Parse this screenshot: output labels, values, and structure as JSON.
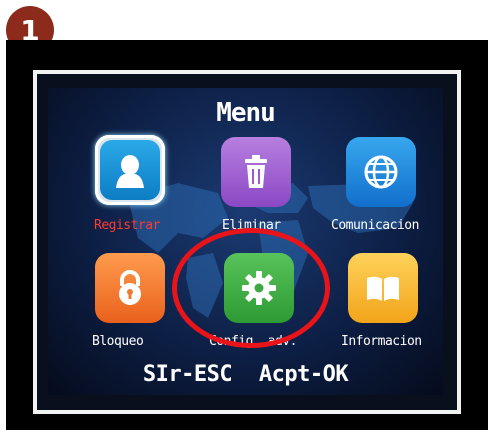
{
  "step": {
    "number": "1"
  },
  "screen": {
    "title": "Menu",
    "items": [
      {
        "label": "Registrar",
        "icon": "user-icon",
        "color": "#1f95dc",
        "selected": true
      },
      {
        "label": "Eliminar",
        "icon": "trash-icon",
        "color": "#9b5bd1",
        "selected": false
      },
      {
        "label": "Comunicacion",
        "icon": "globe-icon",
        "color": "#2a8ee6",
        "selected": false
      },
      {
        "label": "Bloqueo",
        "icon": "lock-icon",
        "color": "#f07a2f",
        "selected": false
      },
      {
        "label": "Config. adv.",
        "icon": "gear-icon",
        "color": "#44b049",
        "selected": false
      },
      {
        "label": "Informacion",
        "icon": "book-icon",
        "color": "#f6b72e",
        "selected": false
      }
    ],
    "footer": "SIr-ESC Acpt-OK"
  },
  "highlight": {
    "color": "#e8141a",
    "target": "Config. adv."
  }
}
